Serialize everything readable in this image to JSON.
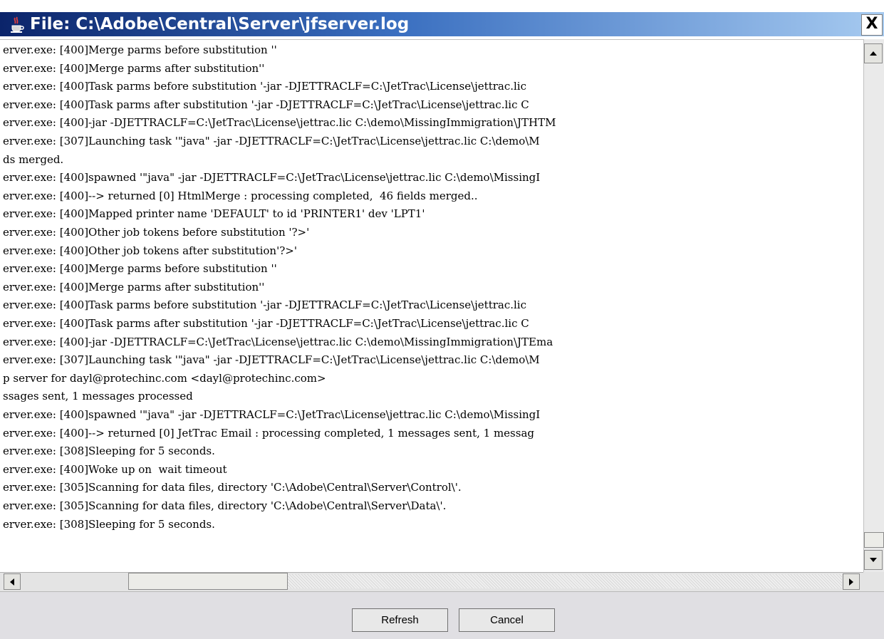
{
  "window": {
    "title": "File: C:\\Adobe\\Central\\Server\\jfserver.log",
    "icon": "java-cup-icon",
    "close_label": "X"
  },
  "log": {
    "lines": [
      "erver.exe: [400]Merge parms before substitution ''",
      "erver.exe: [400]Merge parms after substitution''",
      "erver.exe: [400]Task parms before substitution '-jar -DJETTRACLF=C:\\JetTrac\\License\\jettrac.lic",
      "erver.exe: [400]Task parms after substitution '-jar -DJETTRACLF=C:\\JetTrac\\License\\jettrac.lic C",
      "erver.exe: [400]-jar -DJETTRACLF=C:\\JetTrac\\License\\jettrac.lic C:\\demo\\MissingImmigration\\JTHTM",
      "erver.exe: [307]Launching task '\"java\" -jar -DJETTRACLF=C:\\JetTrac\\License\\jettrac.lic C:\\demo\\M",
      "ds merged.",
      "erver.exe: [400]spawned '\"java\" -jar -DJETTRACLF=C:\\JetTrac\\License\\jettrac.lic C:\\demo\\MissingI",
      "erver.exe: [400]--> returned [0] HtmlMerge : processing completed,  46 fields merged..",
      "erver.exe: [400]Mapped printer name 'DEFAULT' to id 'PRINTER1' dev 'LPT1'",
      "erver.exe: [400]Other job tokens before substitution '?>'",
      "erver.exe: [400]Other job tokens after substitution'?>'",
      "erver.exe: [400]Merge parms before substitution ''",
      "erver.exe: [400]Merge parms after substitution''",
      "erver.exe: [400]Task parms before substitution '-jar -DJETTRACLF=C:\\JetTrac\\License\\jettrac.lic",
      "erver.exe: [400]Task parms after substitution '-jar -DJETTRACLF=C:\\JetTrac\\License\\jettrac.lic C",
      "erver.exe: [400]-jar -DJETTRACLF=C:\\JetTrac\\License\\jettrac.lic C:\\demo\\MissingImmigration\\JTEma",
      "erver.exe: [307]Launching task '\"java\" -jar -DJETTRACLF=C:\\JetTrac\\License\\jettrac.lic C:\\demo\\M",
      "p server for dayl@protechinc.com <dayl@protechinc.com>",
      "ssages sent, 1 messages processed",
      "erver.exe: [400]spawned '\"java\" -jar -DJETTRACLF=C:\\JetTrac\\License\\jettrac.lic C:\\demo\\MissingI",
      "erver.exe: [400]--> returned [0] JetTrac Email : processing completed, 1 messages sent, 1 messag",
      "erver.exe: [308]Sleeping for 5 seconds.",
      "erver.exe: [400]Woke up on  wait timeout",
      "erver.exe: [305]Scanning for data files, directory 'C:\\Adobe\\Central\\Server\\Control\\'.",
      "erver.exe: [305]Scanning for data files, directory 'C:\\Adobe\\Central\\Server\\Data\\'.",
      "erver.exe: [308]Sleeping for 5 seconds."
    ]
  },
  "buttons": {
    "refresh": "Refresh",
    "cancel": "Cancel"
  }
}
